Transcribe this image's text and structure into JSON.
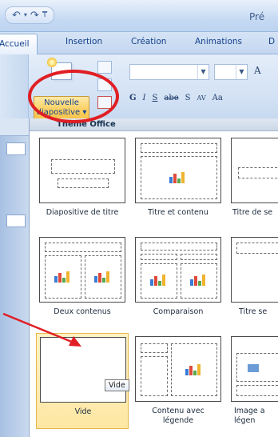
{
  "window": {
    "app_title": "Pré"
  },
  "quick_access": {
    "undo_icon": "undo-icon",
    "redo_icon": "redo-icon",
    "customize_icon": "customize-qat-icon"
  },
  "tabs": [
    {
      "label": "Accueil",
      "active": true
    },
    {
      "label": "Insertion",
      "active": false
    },
    {
      "label": "Création",
      "active": false
    },
    {
      "label": "Animations",
      "active": false
    },
    {
      "label": "D",
      "active": false
    }
  ],
  "ribbon": {
    "new_slide_line1": "Nouvelle",
    "new_slide_line2": "diapositive ▾",
    "grow_font": "A",
    "format_buttons": [
      "G",
      "I",
      "S",
      "abe",
      "S",
      "AV",
      "Aa"
    ]
  },
  "gallery": {
    "header": "Thème Office",
    "layouts": [
      {
        "caption": "Diapositive de titre",
        "selected": false
      },
      {
        "caption": "Titre et contenu",
        "selected": false
      },
      {
        "caption": "Titre de se",
        "selected": false
      },
      {
        "caption": "Deux contenus",
        "selected": false
      },
      {
        "caption": "Comparaison",
        "selected": false
      },
      {
        "caption": "Titre se",
        "selected": false
      },
      {
        "caption": "Vide",
        "selected": true
      },
      {
        "caption": "Contenu avec légende",
        "selected": false
      },
      {
        "caption": "Image a légen",
        "selected": false
      }
    ],
    "tooltip": "Vide"
  },
  "colors": {
    "accent_red": "#e01e24",
    "selected_fill": "#fde7a4",
    "ribbon_blue": "#d2e1f4"
  }
}
